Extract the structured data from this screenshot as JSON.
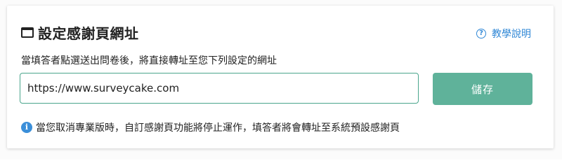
{
  "header": {
    "title": "設定感謝頁網址",
    "help_link_label": "教學說明"
  },
  "description": "當填答者點選送出問卷後，將直接轉址至您下列設定的網址",
  "url_field": {
    "value": "https://www.surveycake.com",
    "placeholder": ""
  },
  "save_button_label": "儲存",
  "notice": "當您取消專業版時，自訂感謝頁功能將停止運作，填答者將會轉址至系統預設感謝頁",
  "icons": {
    "title_icon": "window-icon",
    "help_icon": "question-circle-icon",
    "notice_icon": "info-circle-icon"
  },
  "colors": {
    "accent_green": "#5fb29a",
    "input_border": "#4aa58c",
    "link_blue": "#2f87d6",
    "info_blue": "#3b8fd9"
  }
}
